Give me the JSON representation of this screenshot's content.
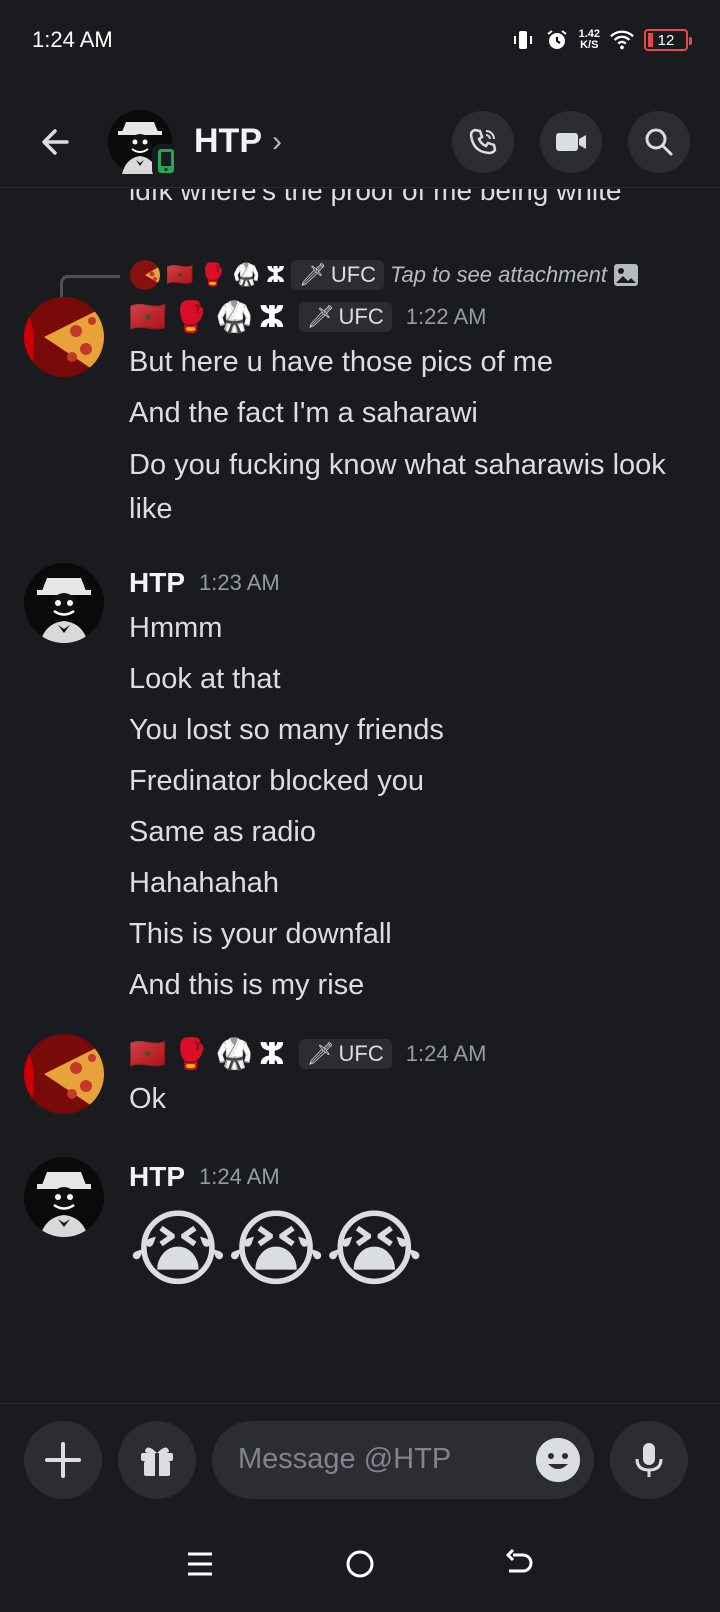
{
  "status_bar": {
    "time": "1:24 AM",
    "net_speed_value": "1.42",
    "net_speed_unit": "K/S",
    "battery": "12"
  },
  "header": {
    "title": "HTP",
    "chevron": "›"
  },
  "conversation": {
    "cut_line": "idfk where's the proof of me being white",
    "reply": {
      "badges": [
        "🇲🇦",
        "🥊",
        "🥋",
        "ⵣ"
      ],
      "tag": "UFC",
      "text": "Tap to see attachment"
    },
    "groups": [
      {
        "author_badges": [
          "🇲🇦",
          "🥊",
          "🥋",
          "ⵣ"
        ],
        "tag": "UFC",
        "time": "1:22 AM",
        "lines": [
          "But here u have those pics of me",
          "And the fact I'm a saharawi",
          "Do you fucking know what saharawis look like"
        ]
      },
      {
        "author": "HTP",
        "time": "1:23 AM",
        "lines": [
          "Hmmm",
          "Look at that",
          "You lost so many friends",
          "Fredinator blocked you",
          "Same as radio",
          "Hahahahah",
          "This is your downfall",
          "And this is my rise"
        ]
      },
      {
        "author_badges": [
          "🇲🇦",
          "🥊",
          "🥋",
          "ⵣ"
        ],
        "tag": "UFC",
        "time": "1:24 AM",
        "lines": [
          "Ok"
        ]
      },
      {
        "author": "HTP",
        "time": "1:24 AM",
        "emojis": [
          "😭",
          "😭",
          "😭"
        ]
      }
    ]
  },
  "composer": {
    "placeholder": "Message @HTP"
  },
  "colors": {
    "background": "#1a1b1e",
    "surface": "#2b2d31",
    "text": "#dbdee1",
    "muted": "#949ba4",
    "battery_low": "#e5484d",
    "online_mobile": "#23a55a"
  }
}
